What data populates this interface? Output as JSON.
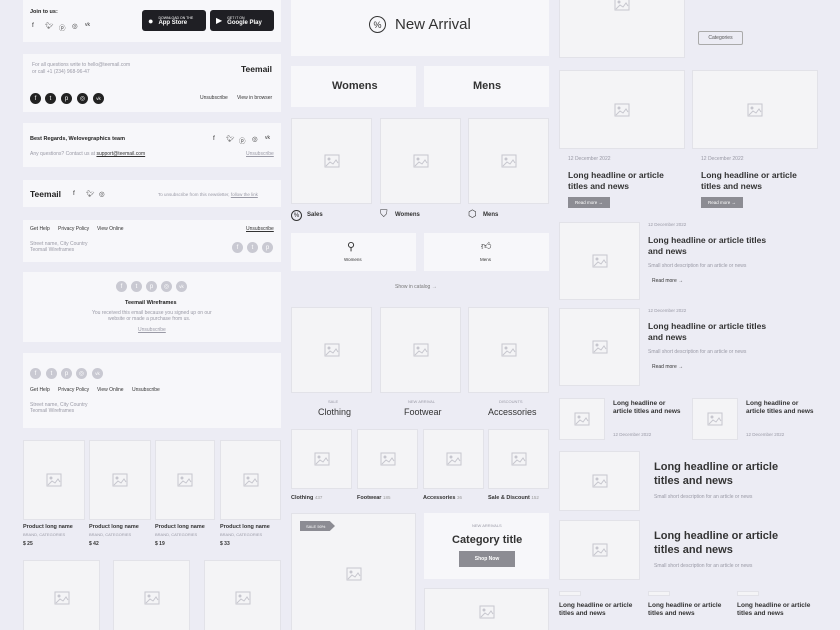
{
  "col1": {
    "joinUs": "Join to us:",
    "appStoreSmall": "DOWNLOAD ON THE",
    "appStore": "App Store",
    "googleSmall": "GET IT ON",
    "googlePlay": "Google Play",
    "questions1": "For all questions write to hello@teemail.com",
    "questions2": "or call +1 (234) 968-96-47",
    "brand": "Teemail",
    "unsubscribe": "Unsubscribe",
    "viewInBrowser": "View in browser",
    "regards": "Best Regards, Welovegraphics team",
    "anyQuestions": "Any questions? Contact us at",
    "supportEmail": "support@teemail.com",
    "unsubscribe2": "Unsubscribe",
    "unsubText": "To unsubscribe from this newsletter,",
    "followLink": "follow the link",
    "getHelp": "Get Help",
    "privacy": "Privacy Policy",
    "viewOnline": "View Online",
    "unsubscribe3": "Unsubscribe",
    "street": "Street name, City Country",
    "wireframes": "Teomail Wireframes",
    "centerTitle": "Teemail Wireframes",
    "centerText1": "You received this email because you signed up on our",
    "centerText2": "website or made a purchase from us.",
    "centerUnsub": "Unsubscribe",
    "getHelp2": "Get Help",
    "privacy2": "Privacy Policy",
    "viewOnline2": "View Online",
    "unsubscribe4": "Unsubscribe",
    "street2": "Street name, City Country",
    "wireframes2": "Teomail Wireframes",
    "products": [
      {
        "name": "Product long name",
        "cat": "BRAND, CATEGORIES",
        "price": "$ 25"
      },
      {
        "name": "Product long name",
        "cat": "BRAND, CATEGORIES",
        "price": "$ 42"
      },
      {
        "name": "Product long name",
        "cat": "BRAND, CATEGORIES",
        "price": "$ 19"
      },
      {
        "name": "Product long name",
        "cat": "BRAND, CATEGORIES",
        "price": "$ 33"
      }
    ]
  },
  "col2": {
    "newArrival": "New Arrival",
    "womens": "Womens",
    "mens": "Mens",
    "salesLabel": "Sales",
    "womensLabel": "Womens",
    "mensLabel": "Mens",
    "womensSmall": "Womens",
    "mensSmall": "Mens",
    "showCatalog": "Show in catalog",
    "cats": [
      {
        "small": "SALE",
        "big": "Clothing"
      },
      {
        "small": "NEW ARRIVAL",
        "big": "Footwear"
      },
      {
        "small": "DISCOUNTS",
        "big": "Accessories"
      }
    ],
    "catCounts": [
      {
        "name": "Clothing",
        "count": "437"
      },
      {
        "name": "Footwear",
        "count": "185"
      },
      {
        "name": "Accessories",
        "count": "36"
      },
      {
        "name": "Sale & Discount",
        "count": "152"
      }
    ],
    "saleBadge": "SALE 50%",
    "newArrivals": "NEW ARRIVALS",
    "categoryTitle": "Category title",
    "shopNow": "Shop Now"
  },
  "col3": {
    "categories": "Categories",
    "date": "12 December 2022",
    "headline": "Long headline or article titles and news",
    "headlineA": "Long headline or article",
    "headlineB": "titles and news",
    "headlineC": "Long headline or",
    "headlineD": "article titles and",
    "headlineE": "news",
    "readMore": "Read more",
    "desc": "Small short description for an article or news"
  }
}
